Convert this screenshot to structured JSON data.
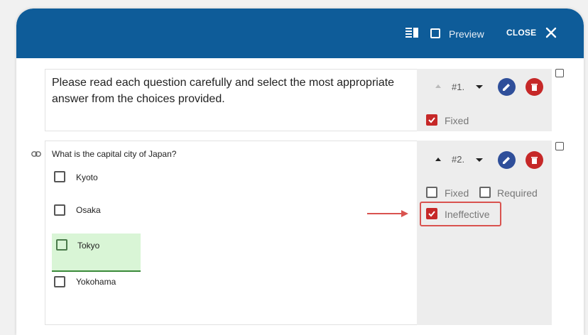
{
  "header": {
    "preview_label": "Preview",
    "close_label": "CLOSE",
    "icons": [
      "toc-icon",
      "checkbox-icon",
      "close-icon"
    ],
    "color": "#0e5c99"
  },
  "intro": {
    "text": "Please read each question carefully and select the most appropriate answer from the choices provided.",
    "number": "#1.",
    "fixed_label": "Fixed",
    "fixed_checked": true
  },
  "question": {
    "title": "What is the capital city of Japan?",
    "number": "#2.",
    "options": [
      {
        "label": "Kyoto",
        "selected": false
      },
      {
        "label": "Osaka",
        "selected": false
      },
      {
        "label": "Tokyo",
        "selected": true
      },
      {
        "label": "Yokohama",
        "selected": false
      }
    ],
    "fixed_label": "Fixed",
    "fixed_checked": false,
    "required_label": "Required",
    "required_checked": false,
    "ineffective_label": "Ineffective",
    "ineffective_checked": true
  },
  "colors": {
    "edit": "#2f4f9a",
    "delete": "#c62828",
    "highlight": "#d9f5d6",
    "annotation": "#d9534f"
  }
}
